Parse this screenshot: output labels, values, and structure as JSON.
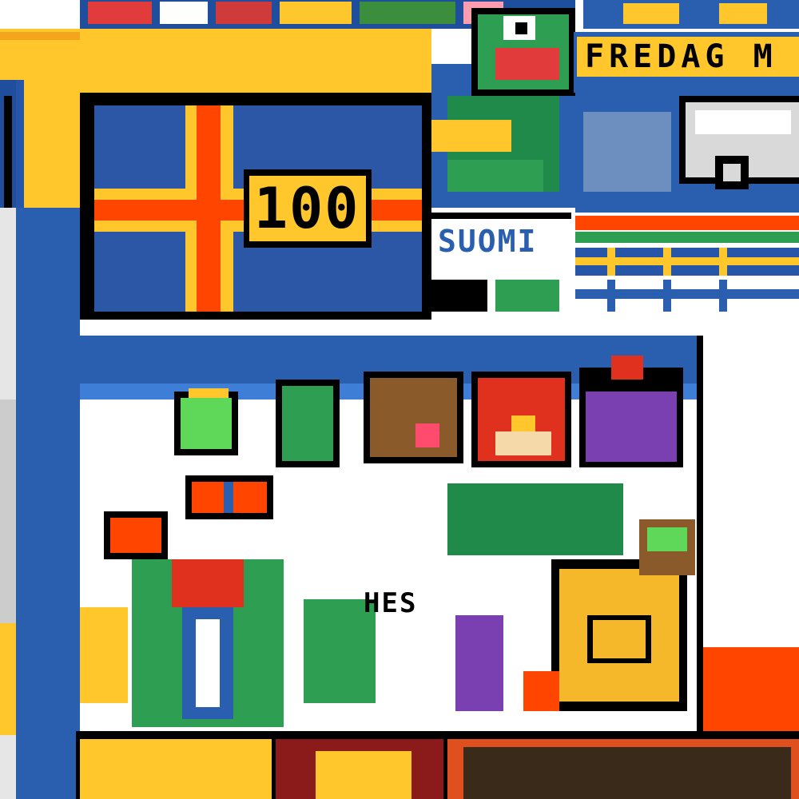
{
  "canvas": {
    "colors": {
      "sweden_blue": "#2756a8",
      "sweden_yellow": "#ffc72b",
      "finland_blue": "#2a5fb0",
      "aland_red": "#ff4500",
      "outline": "#000000",
      "white": "#ffffff"
    }
  },
  "texts": {
    "fredag_banner": "FREDAG M",
    "aland_number": "100",
    "suomi_label": "SUOMI",
    "hes_label": "HES"
  },
  "artworks": [
    {
      "id": "frog",
      "icon": "frog-icon"
    },
    {
      "id": "aland-flag",
      "icon": "aland-flag-icon"
    },
    {
      "id": "van",
      "icon": "van-icon"
    },
    {
      "id": "angry-bird",
      "icon": "red-bird-icon"
    },
    {
      "id": "purple-bird",
      "icon": "purple-bird-icon"
    },
    {
      "id": "potato",
      "icon": "potato-face-icon"
    },
    {
      "id": "trash-can",
      "icon": "trash-can-icon"
    },
    {
      "id": "green-pig",
      "icon": "pig-icon"
    },
    {
      "id": "moomin-house",
      "icon": "tower-icon"
    },
    {
      "id": "brawl-star",
      "icon": "star-badge-icon"
    },
    {
      "id": "heart",
      "icon": "heart-icon"
    }
  ]
}
